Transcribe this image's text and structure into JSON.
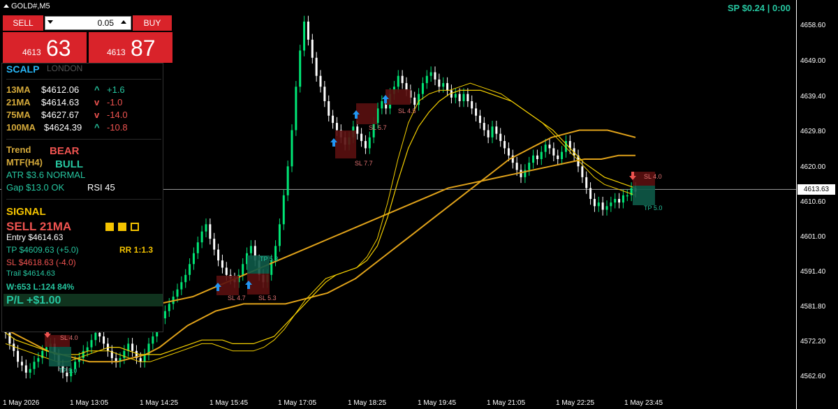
{
  "header": {
    "symbol": "GOLD#,M5",
    "spread": "SP $0.24  |  0:00"
  },
  "trade": {
    "sell_label": "SELL",
    "buy_label": "BUY",
    "lot": "0.05",
    "sell_prefix": "4613",
    "sell_big": "63",
    "buy_prefix": "4613",
    "buy_big": "87"
  },
  "panel": {
    "mode": "SCALP",
    "session": "LONDON",
    "ma": [
      {
        "name": "13MA",
        "value": "$4612.06",
        "dir": "^",
        "change": "+1.6",
        "dir_color": "#26c6a0"
      },
      {
        "name": "21MA",
        "value": "$4614.63",
        "dir": "v",
        "change": "-1.0",
        "dir_color": "#ef5350"
      },
      {
        "name": "75MA",
        "value": "$4627.67",
        "dir": "v",
        "change": "-14.0",
        "dir_color": "#ef5350"
      },
      {
        "name": "100MA",
        "value": "$4624.39",
        "dir": "^",
        "change": "-10.8",
        "dir_color": "#26c6a0"
      }
    ],
    "trend_label": "Trend",
    "trend_value": "BEAR",
    "mtf_label": "MTF(H4)",
    "mtf_value": "BULL",
    "atr": "ATR  $3.6  NORMAL",
    "gap": "Gap $13.0 OK",
    "rsi": "RSI 45",
    "signal_label": "SIGNAL",
    "signal_value": "SELL  21MA",
    "entry": "Entry  $4614.63",
    "tp": "TP  $4609.63  (+5.0)",
    "rr": "RR 1:1.3",
    "sl": "SL  $4618.63  (-4.0)",
    "trail": "Trail $4614.63",
    "winloss": "W:653 L:124  84%",
    "pl": "P/L  +$1.00"
  },
  "axis": {
    "y_ticks": [
      "4658.60",
      "4649.00",
      "4639.40",
      "4629.80",
      "4620.00",
      "4610.60",
      "4601.00",
      "4591.40",
      "4581.80",
      "4572.20",
      "4562.60"
    ],
    "current_price": "4613.63",
    "x_ticks": [
      "1 May 2026",
      "1 May 13:05",
      "1 May 14:25",
      "1 May 15:45",
      "1 May 17:05",
      "1 May 18:25",
      "1 May 19:45",
      "1 May 21:05",
      "1 May 22:25",
      "1 May 23:45"
    ]
  },
  "chart_data": {
    "type": "line",
    "price_range": [
      4557,
      4665
    ],
    "current_price": 4613.63,
    "close_series": [
      4574,
      4571,
      4569,
      4566,
      4565,
      4563,
      4564,
      4566,
      4567,
      4569,
      4570,
      4571,
      4568,
      4565,
      4563,
      4562,
      4564,
      4566,
      4567,
      4569,
      4570,
      4572,
      4574,
      4573,
      4571,
      4569,
      4567,
      4566,
      4567,
      4569,
      4571,
      4569,
      4567,
      4566,
      4568,
      4571,
      4573,
      4576,
      4578,
      4580,
      4582,
      4584,
      4586,
      4588,
      4590,
      4593,
      4596,
      4599,
      4602,
      4604,
      4600,
      4597,
      4594,
      4592,
      4590,
      4589,
      4588,
      4590,
      4593,
      4596,
      4598,
      4594,
      4590,
      4588,
      4590,
      4594,
      4598,
      4604,
      4612,
      4620,
      4630,
      4642,
      4652,
      4660,
      4655,
      4650,
      4645,
      4642,
      4638,
      4634,
      4632,
      4630,
      4628,
      4626,
      4628,
      4631,
      4629,
      4627,
      4625,
      4628,
      4632,
      4636,
      4638,
      4636,
      4640,
      4642,
      4645,
      4643,
      4641,
      4639,
      4637,
      4640,
      4643,
      4645,
      4646,
      4644,
      4642,
      4643,
      4641,
      4639,
      4640,
      4638,
      4640,
      4638,
      4636,
      4634,
      4632,
      4630,
      4628,
      4631,
      4629,
      4627,
      4625,
      4623,
      4621,
      4619,
      4617,
      4619,
      4621,
      4623,
      4622,
      4624,
      4626,
      4625,
      4623,
      4622,
      4624,
      4627,
      4625,
      4623,
      4620,
      4617,
      4614,
      4611,
      4609,
      4610,
      4608,
      4609,
      4610,
      4611,
      4610,
      4612,
      4612,
      4614,
      4613
    ],
    "ma_fast_1": [
      4571,
      4570,
      4569,
      4568,
      4567,
      4566,
      4566,
      4567,
      4568,
      4569,
      4569,
      4568,
      4567,
      4566,
      4566,
      4567,
      4568,
      4569,
      4570,
      4571,
      4571,
      4570,
      4569,
      4569,
      4569,
      4570,
      4572,
      4575,
      4579,
      4583,
      4586,
      4589,
      4590,
      4591,
      4592,
      4595,
      4600,
      4610,
      4622,
      4632,
      4638,
      4640,
      4641,
      4641,
      4642,
      4643,
      4642,
      4641,
      4640,
      4638,
      4636,
      4634,
      4632,
      4629,
      4626,
      4623,
      4620,
      4617,
      4615,
      4614,
      4613,
      4612
    ],
    "ma_fast_2": [
      4574,
      4572,
      4571,
      4570,
      4569,
      4568,
      4568,
      4568,
      4569,
      4569,
      4570,
      4570,
      4569,
      4568,
      4568,
      4568,
      4569,
      4570,
      4571,
      4572,
      4572,
      4572,
      4571,
      4571,
      4571,
      4572,
      4573,
      4576,
      4579,
      4582,
      4585,
      4588,
      4590,
      4591,
      4592,
      4594,
      4598,
      4606,
      4616,
      4625,
      4631,
      4635,
      4638,
      4640,
      4641,
      4641,
      4641,
      4640,
      4639,
      4638,
      4636,
      4634,
      4632,
      4630,
      4627,
      4624,
      4621,
      4619,
      4617,
      4616,
      4615,
      4614
    ],
    "ma_slow_1": [
      4575,
      4573,
      4571,
      4569,
      4568,
      4567,
      4566,
      4566,
      4566,
      4567,
      4568,
      4570,
      4573,
      4576,
      4578,
      4580,
      4581,
      4582,
      4582,
      4582,
      4582,
      4583,
      4584,
      4585,
      4587,
      4589,
      4592,
      4595,
      4598,
      4601,
      4604,
      4607,
      4610,
      4613,
      4616,
      4619,
      4622,
      4624,
      4626,
      4628,
      4629,
      4630,
      4630,
      4630,
      4629,
      4628
    ],
    "ma_slow_2": [
      4587,
      4586,
      4585,
      4584,
      4583,
      4583,
      4582,
      4582,
      4582,
      4582,
      4583,
      4584,
      4586,
      4588,
      4590,
      4592,
      4594,
      4596,
      4598,
      4600,
      4602,
      4604,
      4606,
      4608,
      4610,
      4612,
      4614,
      4615,
      4616,
      4617,
      4618,
      4619,
      4620,
      4621,
      4622,
      4622,
      4623,
      4623
    ],
    "trade_boxes": [
      {
        "kind": "TP",
        "label": "TP 5.0"
      },
      {
        "kind": "SL",
        "label": "SL 4.0"
      },
      {
        "kind": "SL",
        "label": "SL 7.7"
      },
      {
        "kind": "SL",
        "label": "SL 5.7"
      },
      {
        "kind": "SL",
        "label": "SL 4.5"
      },
      {
        "kind": "SL",
        "label": "SL 4.7"
      },
      {
        "kind": "SL",
        "label": "SL 5.3"
      },
      {
        "kind": "TP",
        "label": "TP 5.3"
      },
      {
        "kind": "TP",
        "label": "TP 5.0"
      },
      {
        "kind": "SL",
        "label": "SL 4.0"
      }
    ],
    "colors": {
      "bull": "#00e676",
      "bear": "#ffffff",
      "ma_fast": "#f5d000",
      "ma_slow": "#e0a21a",
      "tp": "#0e5a48",
      "sl": "#5a1010",
      "arrow_up": "#2196f3",
      "arrow_down": "#ef5350"
    }
  }
}
